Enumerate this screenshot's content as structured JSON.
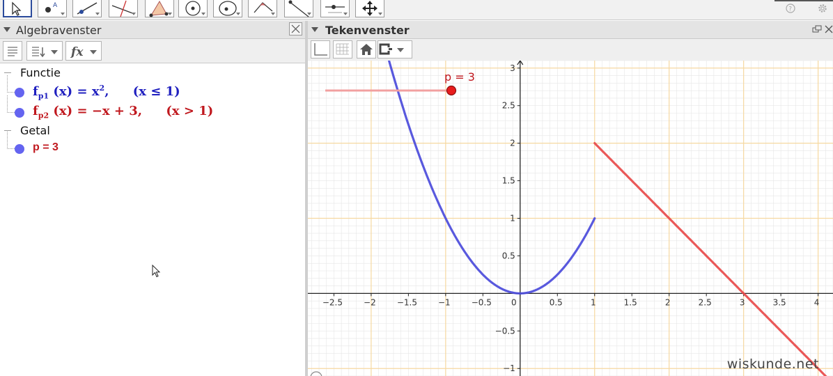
{
  "toolbar": {
    "tools": [
      {
        "name": "move-tool-icon",
        "selected": true
      },
      {
        "name": "point-tool-icon"
      },
      {
        "name": "line-tool-icon"
      },
      {
        "name": "perpendicular-line-tool-icon"
      },
      {
        "name": "polygon-tool-icon"
      },
      {
        "name": "circle-with-center-tool-icon"
      },
      {
        "name": "ellipse-tool-icon"
      },
      {
        "name": "angle-tool-icon"
      },
      {
        "name": "reflect-tool-icon"
      },
      {
        "name": "slider-tool-icon"
      },
      {
        "name": "move-graphics-view-tool-icon"
      }
    ],
    "right_icons": [
      "help-icon",
      "settings-icon"
    ]
  },
  "algebra": {
    "title": "Algebravenster",
    "tools": [
      "auxiliary-objects-icon",
      "sort-icon",
      "function-fx-icon"
    ],
    "groups": [
      {
        "label": "Functie"
      },
      {
        "label": "Getal"
      }
    ],
    "entries": {
      "fp1": {
        "name": "f",
        "sub": "p1",
        "arg": "(x)",
        "eq": "=",
        "rhs": "x",
        "exp": "2",
        "comma": ",",
        "cond": "(x ≤ 1)",
        "color": "#1f1fbf",
        "dot_color": "#6464f0"
      },
      "fp2": {
        "name": "f",
        "sub": "p2",
        "arg": "(x)",
        "eq": "=",
        "rhs": "−x + 3,",
        "cond": "(x > 1)",
        "color": "#c0181e",
        "dot_color": "#6464f0"
      },
      "p": {
        "text": "p = 3",
        "color": "#c0181e",
        "dot_color": "#6464f0"
      }
    }
  },
  "graphics": {
    "title": "Tekenvenster",
    "tools": [
      "axes-toggle-icon",
      "grid-toggle-icon",
      "home-icon",
      "point-capturing-icon"
    ],
    "watermark": "wiskunde.net",
    "slider": {
      "label": "p = 3",
      "value": 3,
      "color": "#e84a4a"
    },
    "colors": {
      "parabola": "#4b4bdb",
      "line": "#e84a4a",
      "grid_major": "#f6d8a0",
      "grid_minor": "#e6e6e6"
    }
  },
  "chart_data": {
    "type": "line",
    "title": "",
    "xlabel": "",
    "ylabel": "",
    "xlim": [
      -2.85,
      4.2
    ],
    "ylim": [
      -1.1,
      3.1
    ],
    "grid": true,
    "x_ticks": [
      -2.5,
      -2,
      -1.5,
      -1,
      -0.5,
      0,
      0.5,
      1,
      1.5,
      2,
      2.5,
      3,
      3.5,
      4
    ],
    "x_tick_labels": [
      "−2.5",
      "−2",
      "−1.5",
      "−1",
      "−0.5",
      "0",
      "0.5",
      "1",
      "1.5",
      "2",
      "2.5",
      "3",
      "3.5",
      "4"
    ],
    "y_ticks": [
      -1,
      -0.5,
      0.5,
      1,
      1.5,
      2,
      2.5,
      3
    ],
    "y_tick_labels": [
      "−1",
      "−0.5",
      "0.5",
      "1",
      "1.5",
      "2",
      "2.5",
      "3"
    ],
    "series": [
      {
        "name": "fp1",
        "domain": [
          -1.8,
          1
        ],
        "formula": "x^2",
        "color": "#4b4bdb"
      },
      {
        "name": "fp2",
        "domain": [
          1,
          4.2
        ],
        "formula": "-x+3",
        "color": "#e84a4a"
      }
    ]
  }
}
